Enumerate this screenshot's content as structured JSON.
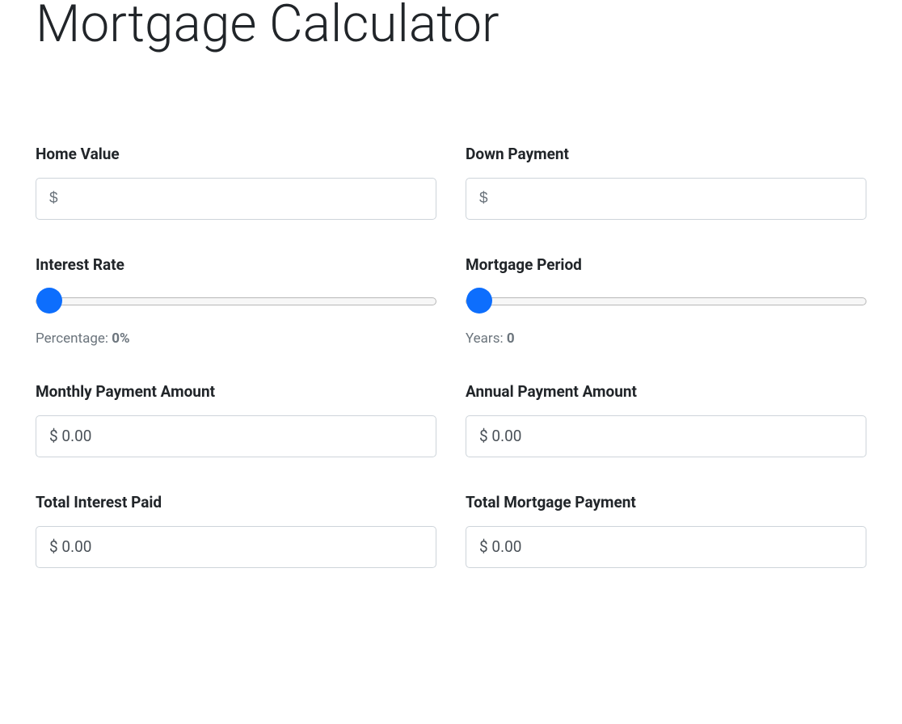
{
  "title": "Mortgage Calculator",
  "fields": {
    "home_value": {
      "label": "Home Value",
      "placeholder": "$",
      "value": ""
    },
    "down_payment": {
      "label": "Down Payment",
      "placeholder": "$",
      "value": ""
    },
    "interest_rate": {
      "label": "Interest Rate",
      "caption_prefix": "Percentage: ",
      "caption_value": "0%",
      "slider_value": "0"
    },
    "mortgage_period": {
      "label": "Mortgage Period",
      "caption_prefix": "Years: ",
      "caption_value": "0",
      "slider_value": "0"
    },
    "monthly_payment": {
      "label": "Monthly Payment Amount",
      "value": "$ 0.00"
    },
    "annual_payment": {
      "label": "Annual Payment Amount",
      "value": "$ 0.00"
    },
    "total_interest": {
      "label": "Total Interest Paid",
      "value": "$ 0.00"
    },
    "total_mortgage": {
      "label": "Total Mortgage Payment",
      "value": "$ 0.00"
    }
  }
}
